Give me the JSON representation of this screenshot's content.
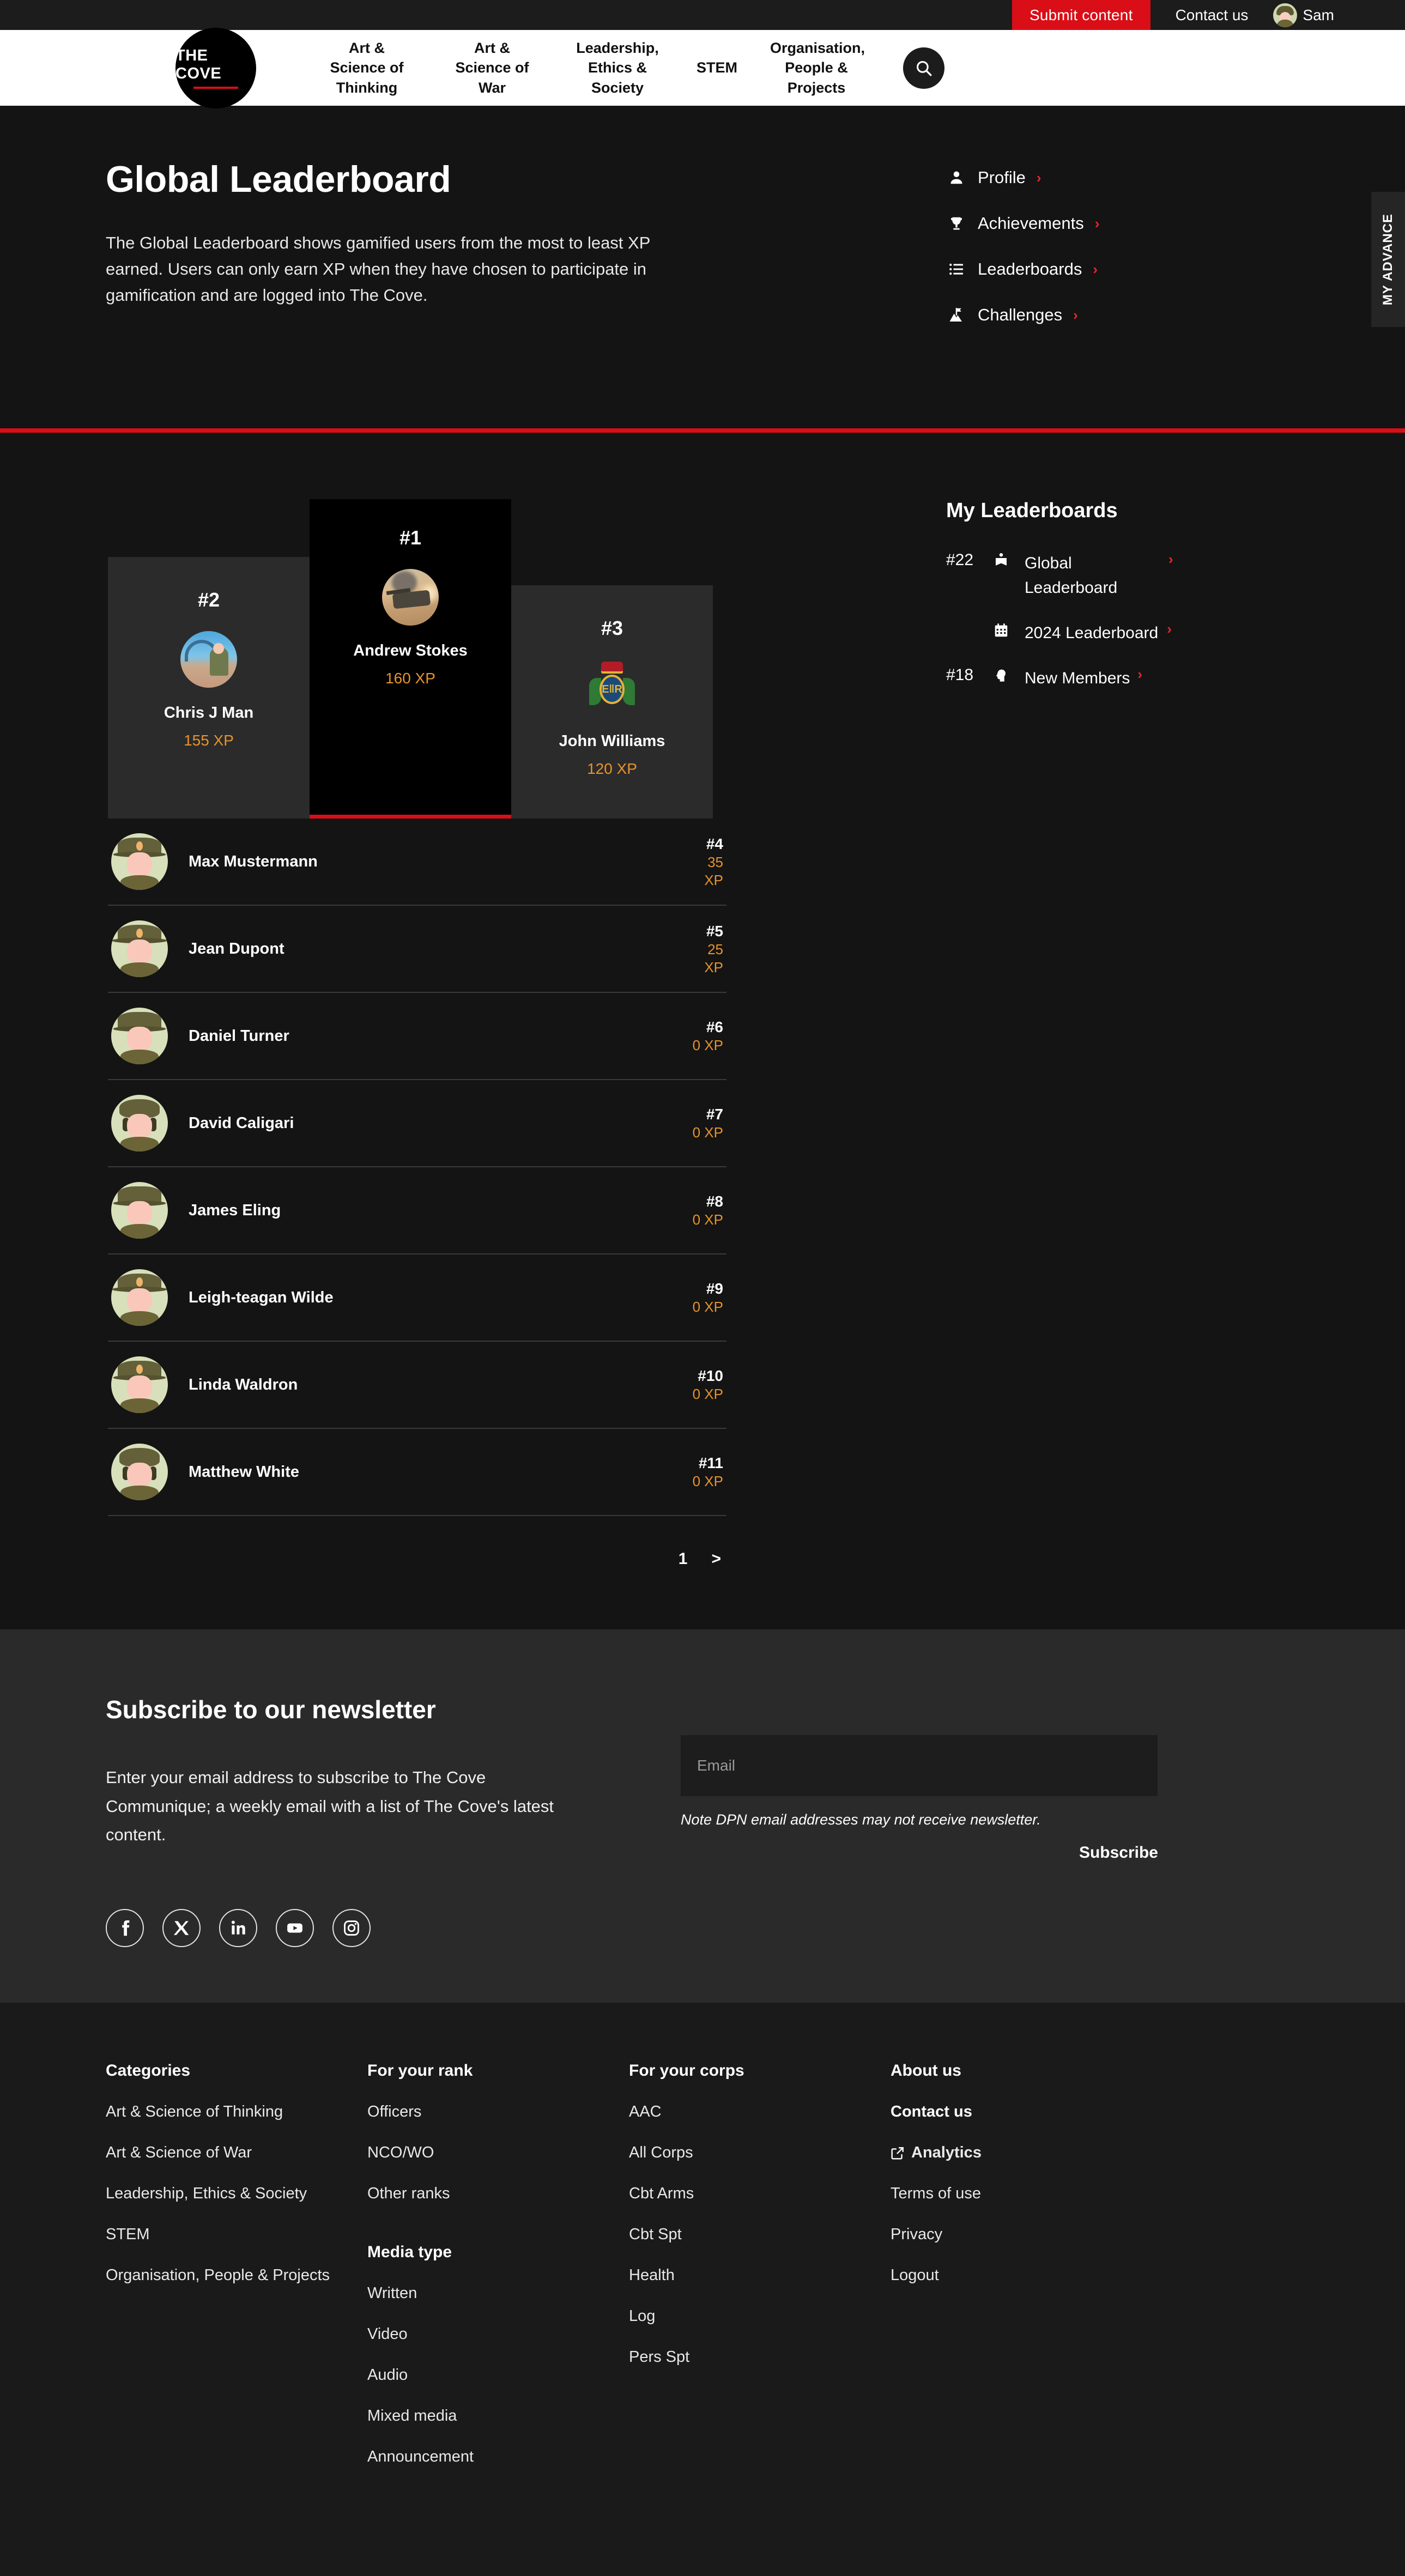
{
  "utility_bar": {
    "submit_label": "Submit content",
    "contact_label": "Contact us",
    "user_name": "Sam"
  },
  "nav": {
    "logo_text": "THE COVE",
    "items": [
      {
        "label": "Art & Science of Thinking"
      },
      {
        "label": "Art & Science of War"
      },
      {
        "label": "Leadership, Ethics & Society"
      },
      {
        "label": "STEM"
      },
      {
        "label": "Organisation, People & Projects"
      }
    ],
    "search_icon": "search-icon"
  },
  "hero": {
    "title": "Global Leaderboard",
    "description": "The Global Leaderboard shows gamified users from the most to least XP earned. Users can only earn XP when they have chosen to participate in gamification and are logged into The Cove.",
    "links": [
      {
        "label": "Profile",
        "icon": "user-icon",
        "chevron": "›"
      },
      {
        "label": "Achievements",
        "icon": "trophy-icon",
        "chevron": "›"
      },
      {
        "label": "Leaderboards",
        "icon": "list-icon",
        "chevron": "›"
      },
      {
        "label": "Challenges",
        "icon": "flag-mountain-icon",
        "chevron": "›"
      }
    ],
    "advance_tab_label": "MY ADVANCE"
  },
  "podium": [
    {
      "rank": "#2",
      "name": "Chris J Man",
      "xp": "155 XP"
    },
    {
      "rank": "#1",
      "name": "Andrew Stokes",
      "xp": "160 XP"
    },
    {
      "rank": "#3",
      "name": "John Williams",
      "xp": "120 XP"
    }
  ],
  "rank_list": [
    {
      "rank": "#4",
      "name": "Max Mustermann",
      "xp": "35 XP"
    },
    {
      "rank": "#5",
      "name": "Jean Dupont",
      "xp": "25 XP"
    },
    {
      "rank": "#6",
      "name": "Daniel Turner",
      "xp": "0 XP"
    },
    {
      "rank": "#7",
      "name": "David Caligari",
      "xp": "0 XP"
    },
    {
      "rank": "#8",
      "name": "James Eling",
      "xp": "0 XP"
    },
    {
      "rank": "#9",
      "name": "Leigh-teagan Wilde",
      "xp": "0 XP"
    },
    {
      "rank": "#10",
      "name": "Linda Waldron",
      "xp": "0 XP"
    },
    {
      "rank": "#11",
      "name": "Matthew White",
      "xp": "0 XP"
    }
  ],
  "pagination": {
    "current_page": "1",
    "next_label": ">"
  },
  "my_leaderboards": {
    "title": "My Leaderboards",
    "items": [
      {
        "rank": "#22",
        "icon": "book-icon",
        "label": "Global Leaderboard",
        "chevron": "›"
      },
      {
        "rank": "",
        "icon": "calendar-icon",
        "label": "2024 Leaderboard",
        "chevron": "›"
      },
      {
        "rank": "#18",
        "icon": "head-icon",
        "label": "New Members",
        "chevron": "›"
      }
    ]
  },
  "newsletter": {
    "heading": "Subscribe to our newsletter",
    "body": "Enter your email address to subscribe to The Cove Communique; a weekly email with a list of The Cove's latest content.",
    "email_placeholder": "Email",
    "email_value": "",
    "note": "Note DPN email addresses may not receive newsletter.",
    "subscribe_label": "Subscribe",
    "socials": [
      {
        "name": "facebook-icon"
      },
      {
        "name": "x-twitter-icon"
      },
      {
        "name": "linkedin-icon"
      },
      {
        "name": "youtube-icon"
      },
      {
        "name": "instagram-icon"
      }
    ]
  },
  "footer": {
    "col1": {
      "heading": "Categories",
      "links": [
        "Art & Science of Thinking",
        "Art & Science of War",
        "Leadership, Ethics & Society",
        "STEM",
        "Organisation, People & Projects"
      ]
    },
    "col2": {
      "heading": "For your rank",
      "links": [
        "Officers",
        "NCO/WO",
        "Other ranks"
      ],
      "heading2": "Media type",
      "links2": [
        "Written",
        "Video",
        "Audio",
        "Mixed media",
        "Announcement"
      ]
    },
    "col3": {
      "heading": "For your corps",
      "links": [
        "AAC",
        "All Corps",
        "Cbt Arms",
        "Cbt Spt",
        "Health",
        "Log",
        "Pers Spt"
      ]
    },
    "col4": {
      "heading": "About us",
      "contact": "Contact us",
      "analytics": "Analytics",
      "links": [
        "Terms of use",
        "Privacy",
        "Logout"
      ]
    }
  },
  "colors": {
    "brand_red": "#d90e17",
    "xp_orange": "#e8932b",
    "page_bg": "#141414",
    "newsletter_bg": "#2a2a2a",
    "footer_bg": "#1a1a1a"
  }
}
